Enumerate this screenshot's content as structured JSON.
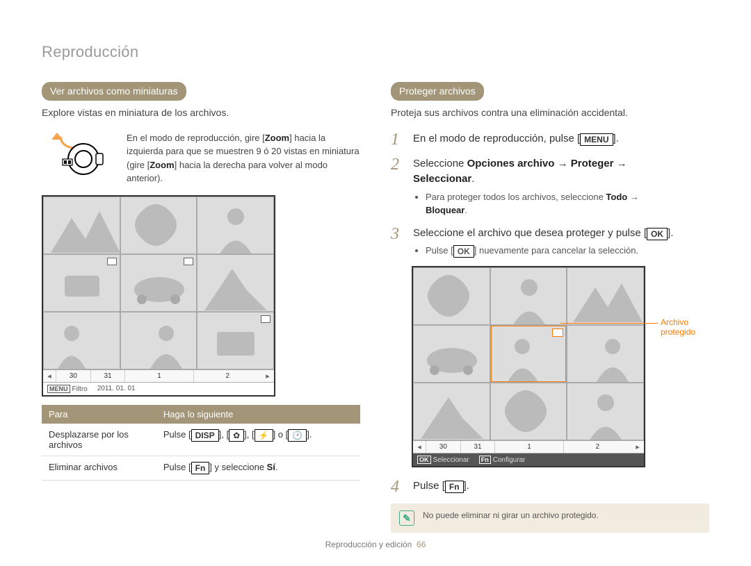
{
  "page": {
    "breadcrumb": "Reproducción",
    "footer_section": "Reproducción y edición",
    "footer_page": "66"
  },
  "left": {
    "pill": "Ver archivos como miniaturas",
    "intro": "Explore vistas en miniatura de los archivos.",
    "zoom_tip_pre": "En el modo de reproducción, gire [",
    "zoom_key": "Zoom",
    "zoom_tip_mid": "] hacia la izquierda para que se muestren 9 ó 20 vistas en miniatura (gire [",
    "zoom_tip_end": "] hacia la derecha para volver al modo anterior).",
    "lcd": {
      "nums": [
        "30",
        "31",
        "1",
        "2"
      ],
      "menu_key": "MENU",
      "filter_label": "Filtro",
      "date": "2011. 01. 01"
    },
    "table": {
      "h1": "Para",
      "h2": "Haga lo siguiente",
      "r1c1": "Desplazarse por los archivos",
      "r1c2_pre": "Pulse [",
      "r1c2_disp": "DISP",
      "r1c2_mid1": "], [",
      "r1c2_mid2": "], [",
      "r1c2_mid3": "] o [",
      "r1c2_end": "].",
      "r2c1": "Eliminar archivos",
      "r2c2_pre": "Pulse [",
      "r2c2_fn": "Fn",
      "r2c2_mid": "] y seleccione ",
      "r2c2_si": "Sí",
      "r2c2_end": "."
    }
  },
  "right": {
    "pill": "Proteger archivos",
    "intro": "Proteja sus archivos contra una eliminación accidental.",
    "steps": {
      "s1_pre": "En el modo de reproducción, pulse [",
      "s1_menu": "MENU",
      "s1_end": "].",
      "s2_pre": "Seleccione ",
      "s2_bold1": "Opciones archivo",
      "s2_arrow": " → ",
      "s2_bold2": "Proteger",
      "s2_bold3": "Seleccionar",
      "s2_end": ".",
      "s2_sub_pre": "Para proteger todos los archivos, seleccione ",
      "s2_sub_bold1": "Todo",
      "s2_sub_bold2": "Bloquear",
      "s3_pre": "Seleccione el archivo que desea proteger y pulse [",
      "s3_ok": "OK",
      "s3_end": "].",
      "s3_sub_pre": "Pulse [",
      "s3_sub_end": "] nuevamente para cancelar la selección.",
      "s4_pre": "Pulse [",
      "s4_fn": "Fn",
      "s4_end": "]."
    },
    "callout_label": "Archivo protegido",
    "lcd": {
      "nums": [
        "30",
        "31",
        "1",
        "2"
      ],
      "ok_key": "OK",
      "select_label": "Seleccionar",
      "fn_key": "Fn",
      "config_label": "Configurar"
    },
    "note": "No puede eliminar ni girar un archivo protegido."
  }
}
